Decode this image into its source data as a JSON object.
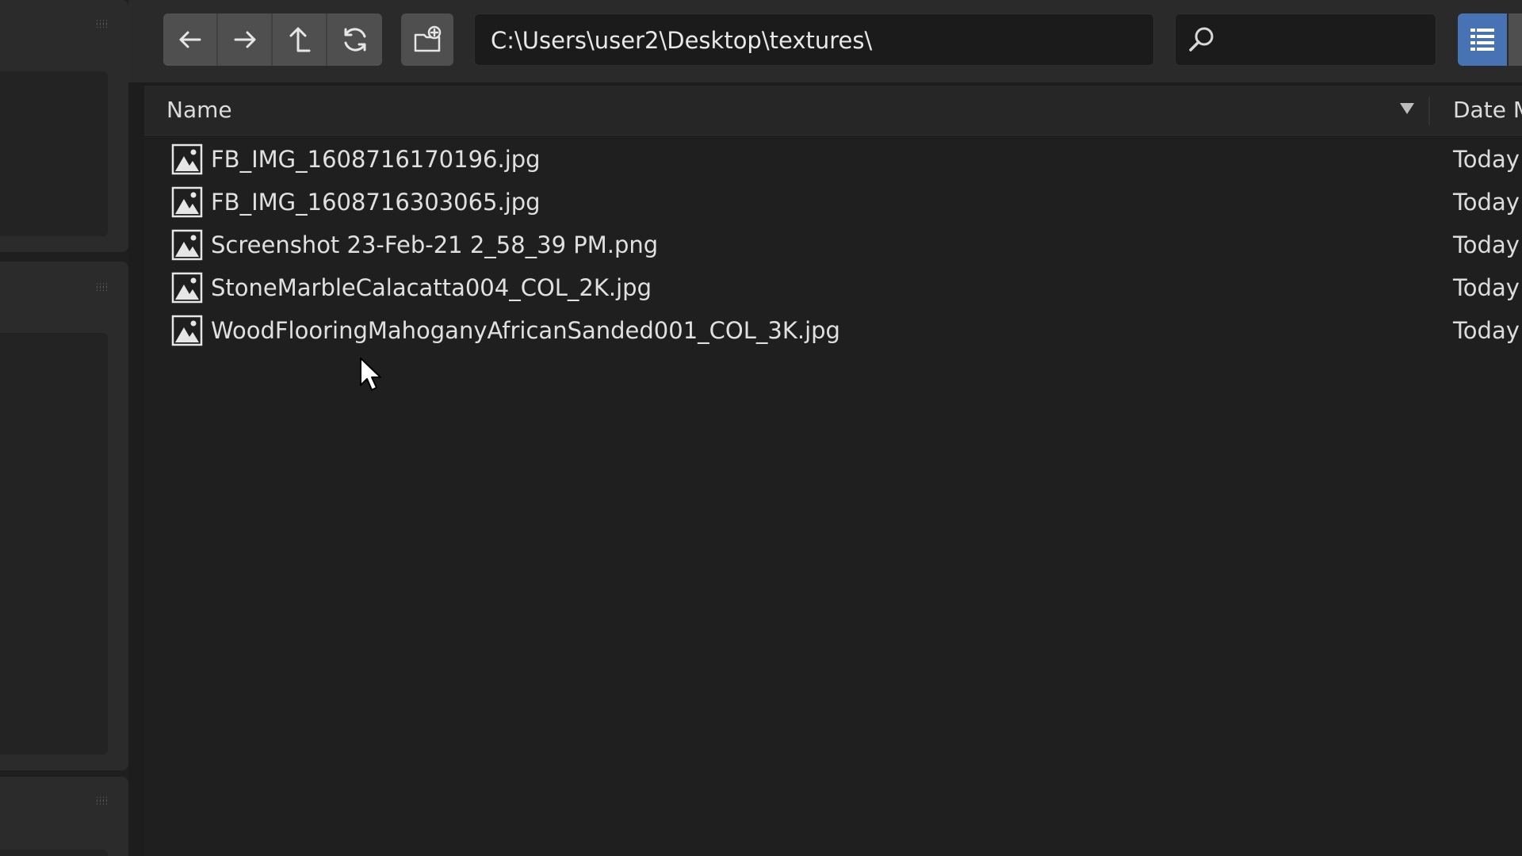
{
  "toolbar": {
    "nav": [
      {
        "name": "back-button",
        "icon": "arrow-left-icon"
      },
      {
        "name": "forward-button",
        "icon": "arrow-right-icon"
      },
      {
        "name": "parent-directory-button",
        "icon": "arrow-up-icon"
      },
      {
        "name": "refresh-button",
        "icon": "refresh-icon"
      }
    ],
    "new_directory_icon": "new-folder-icon",
    "path": "C:\\Users\\user2\\Desktop\\textures\\",
    "search_value": "",
    "search_icon": "search-icon",
    "view_mode_icon": "list-view-icon"
  },
  "columns": {
    "name": "Name",
    "date": "Date M"
  },
  "files": [
    {
      "name": "FB_IMG_1608716170196.jpg",
      "date": "Today"
    },
    {
      "name": "FB_IMG_1608716303065.jpg",
      "date": "Today"
    },
    {
      "name": "Screenshot 23-Feb-21 2_58_39 PM.png",
      "date": "Today"
    },
    {
      "name": "StoneMarbleCalacatta004_COL_2K.jpg",
      "date": "Today"
    },
    {
      "name": "WoodFlooringMahoganyAfricanSanded001_COL_3K.jpg",
      "date": "Today"
    }
  ],
  "colors": {
    "accent": "#4772b3",
    "background": "#1d1d1d",
    "toolbar": "#2a2a2a"
  }
}
